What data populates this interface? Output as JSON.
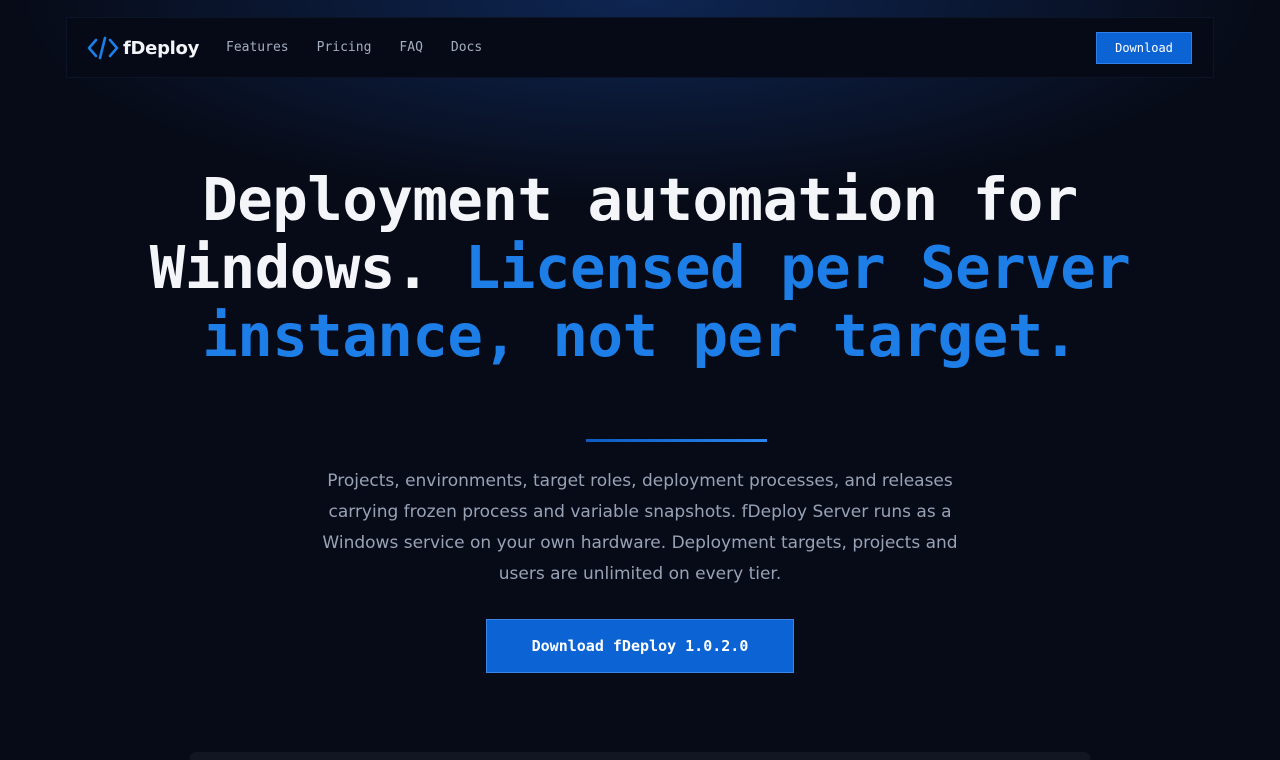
{
  "brand": {
    "name": "fDeploy",
    "icon": "code-brackets-icon",
    "accent_color": "#1d7ee8"
  },
  "nav": {
    "links": [
      {
        "label": "Features"
      },
      {
        "label": "Pricing"
      },
      {
        "label": "FAQ"
      },
      {
        "label": "Docs"
      }
    ],
    "download_label": "Download"
  },
  "hero": {
    "title_main": "Deployment automation for Windows.",
    "title_accent": "Licensed per Server instance, not per target.",
    "description": "Projects, environments, target roles, deployment processes, and releases carrying frozen process and variable snapshots. fDeploy Server runs as a Windows service on your own hardware. Deployment targets, projects and users are unlimited on every tier.",
    "cta_label": "Download fDeploy 1.0.2.0"
  },
  "colors": {
    "background": "#070b18",
    "primary_button": "#0c63d4",
    "title_text": "#f3f5f9",
    "body_text": "#98a2b5"
  }
}
